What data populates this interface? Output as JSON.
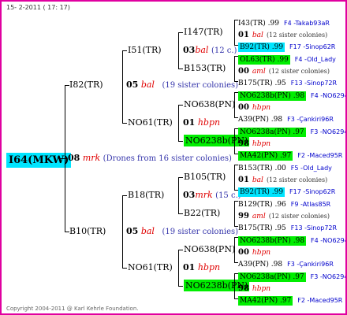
{
  "header": "15- 2-2011 ( 17: 17)",
  "footer": "Copyright 2004-2011 @ Karl Kehrle Foundation.",
  "root": {
    "id": "I64(MKW)",
    "year": "08",
    "name": "mrk",
    "note": "(Drones from 16 sister colonies)"
  },
  "gen1": [
    {
      "id": "I82(TR)",
      "year": "05",
      "name": "bal",
      "note": "(19 sister colonies)"
    },
    {
      "id": "B10(TR)",
      "year": "05",
      "name": "bal",
      "note": "(19 sister colonies)"
    }
  ],
  "gen2": [
    {
      "id": "I51(TR)",
      "year": "03",
      "name": "bal",
      "note": "(12 c.)"
    },
    {
      "id": "NO61(TR)",
      "year": "01",
      "name": "hbpn",
      "note": ""
    },
    {
      "id": "B18(TR)",
      "year": "03",
      "name": "mrk",
      "note": "(15 c.)"
    },
    {
      "id": "NO61(TR)",
      "year": "01",
      "name": "hbpn",
      "note": ""
    }
  ],
  "gen3": [
    "I147(TR)",
    "B153(TR)",
    "NO638(PN)",
    "NO6238b(PN)",
    "B105(TR)",
    "B22(TR)",
    "NO638(PN)",
    "NO6238b(PN)"
  ],
  "gen4": [
    {
      "line": "I43(TR) .99",
      "ref": "F4 -Takab93aR",
      "hl": ""
    },
    {
      "line": "01",
      "name": "bal",
      "note": "(12 sister colonies)",
      "hl": ""
    },
    {
      "line": "B92(TR) .99",
      "ref": "F17 -Sinop62R",
      "hl": "c"
    },
    {
      "line": "OL63(TR) .99",
      "ref": "F4 -Old_Lady",
      "hl": "g"
    },
    {
      "line": "00",
      "name": "aml",
      "note": "(12 sister colonies)",
      "hl": ""
    },
    {
      "line": "B175(TR) .95",
      "ref": "F13 -Sinop72R",
      "hl": ""
    },
    {
      "line": "NO6238b(PN) .98",
      "ref": "F4 -NO6294R",
      "hl": "g"
    },
    {
      "line": "00",
      "name": "hbpn",
      "note": "",
      "hl": ""
    },
    {
      "line": "A39(PN) .98",
      "ref": "F3 -Çankiri96R",
      "hl": ""
    },
    {
      "line": "NO6238a(PN) .97",
      "ref": "F3 -NO6294R",
      "hl": "g"
    },
    {
      "line": "98",
      "name": "hbpn",
      "note": "",
      "hl": ""
    },
    {
      "line": "MA42(PN) .97",
      "ref": "F2 -Maced95R",
      "hl": "g"
    },
    {
      "line": "B153(TR) .00",
      "ref": "F5 -Old_Lady",
      "hl": ""
    },
    {
      "line": "01",
      "name": "bal",
      "note": "(12 sister colonies)",
      "hl": ""
    },
    {
      "line": "B92(TR) .99",
      "ref": "F17 -Sinop62R",
      "hl": "c"
    },
    {
      "line": "B129(TR) .96",
      "ref": "F9 -Atlas85R",
      "hl": ""
    },
    {
      "line": "99",
      "name": "aml",
      "note": "(12 sister colonies)",
      "hl": ""
    },
    {
      "line": "B175(TR) .95",
      "ref": "F13 -Sinop72R",
      "hl": ""
    },
    {
      "line": "NO6238b(PN) .98",
      "ref": "F4 -NO6294R",
      "hl": "g"
    },
    {
      "line": "00",
      "name": "hbpn",
      "note": "",
      "hl": ""
    },
    {
      "line": "A39(PN) .98",
      "ref": "F3 -Çankiri96R",
      "hl": ""
    },
    {
      "line": "NO6238a(PN) .97",
      "ref": "F3 -NO6294R",
      "hl": "g"
    },
    {
      "line": "98",
      "name": "hbpn",
      "note": "",
      "hl": ""
    },
    {
      "line": "MA42(PN) .97",
      "ref": "F2 -Maced95R",
      "hl": "g"
    }
  ]
}
